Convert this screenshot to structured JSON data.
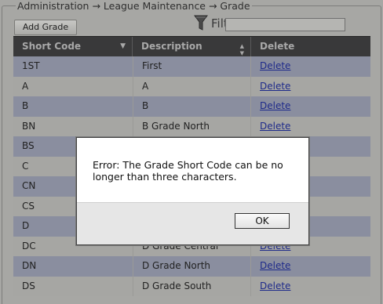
{
  "breadcrumb": "Administration → League Maintenance → Grade",
  "toolbar": {
    "add_label": "Add Grade",
    "filter_label": "Filter:",
    "filter_value": ""
  },
  "grid": {
    "columns": [
      "Short Code",
      "Description",
      "Delete"
    ],
    "rows": [
      {
        "code": "1ST",
        "description": "First",
        "delete": "Delete"
      },
      {
        "code": "A",
        "description": "A",
        "delete": "Delete"
      },
      {
        "code": "B",
        "description": "B",
        "delete": "Delete"
      },
      {
        "code": "BN",
        "description": "B Grade North",
        "delete": "Delete"
      },
      {
        "code": "BS",
        "description": "",
        "delete": ""
      },
      {
        "code": "C",
        "description": "",
        "delete": ""
      },
      {
        "code": "CN",
        "description": "",
        "delete": ""
      },
      {
        "code": "CS",
        "description": "",
        "delete": ""
      },
      {
        "code": "D",
        "description": "",
        "delete": ""
      },
      {
        "code": "DC",
        "description": "D Grade Central",
        "delete": "Delete"
      },
      {
        "code": "DN",
        "description": "D Grade North",
        "delete": "Delete"
      },
      {
        "code": "DS",
        "description": "D Grade South",
        "delete": "Delete"
      }
    ]
  },
  "dialog": {
    "message": "Error: The Grade Short Code can be no longer than three characters.",
    "ok_label": "OK"
  },
  "icons": {
    "filter": "funnel-icon",
    "sort_asc": "sort-down-icon",
    "sort_both": "sort-both-icon"
  }
}
